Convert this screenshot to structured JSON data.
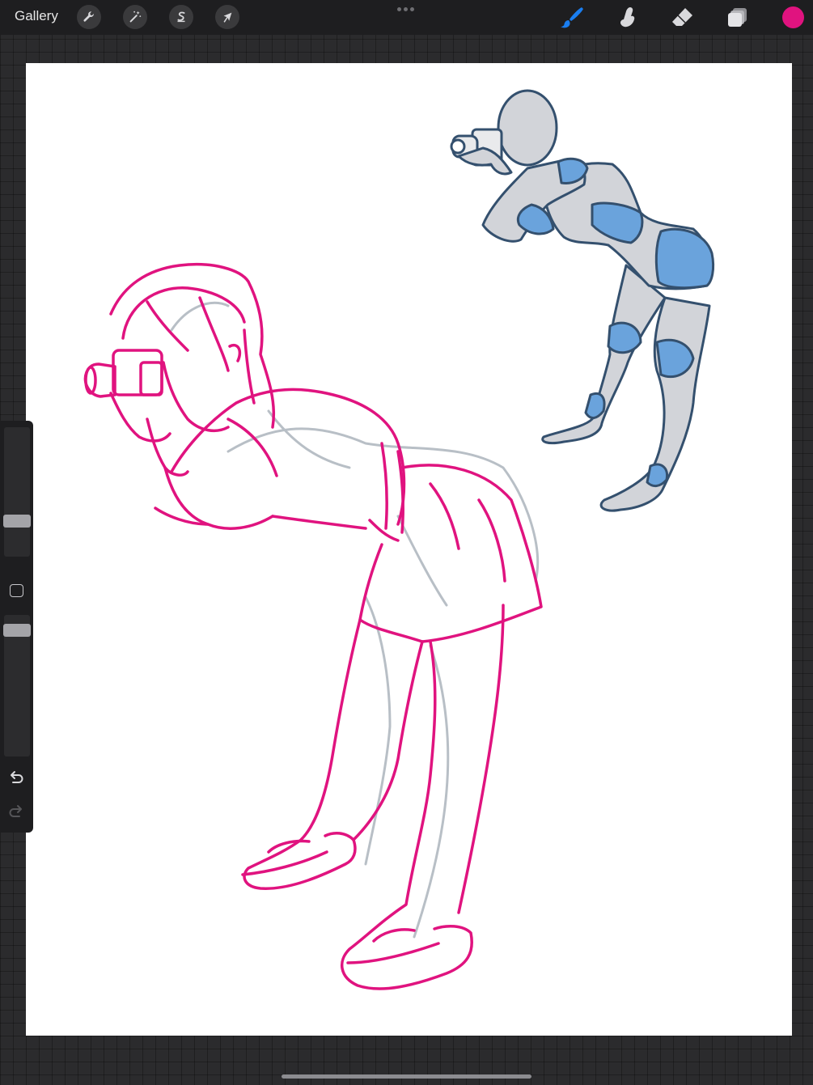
{
  "topbar": {
    "gallery_label": "Gallery",
    "left_tools": [
      {
        "name": "actions",
        "icon": "wrench-icon"
      },
      {
        "name": "adjustments",
        "icon": "magic-wand-icon"
      },
      {
        "name": "selection",
        "icon": "selection-s-icon"
      },
      {
        "name": "transform",
        "icon": "arrow-cursor-icon"
      }
    ],
    "right_tools": [
      {
        "name": "brush",
        "icon": "brush-icon",
        "active": true
      },
      {
        "name": "smudge",
        "icon": "smudge-finger-icon",
        "active": false
      },
      {
        "name": "eraser",
        "icon": "eraser-icon",
        "active": false
      },
      {
        "name": "layers",
        "icon": "layers-icon",
        "active": false
      }
    ],
    "active_color": "#e0137f"
  },
  "sidebar": {
    "brush_size": 0.29,
    "brush_opacity": 0.95,
    "modify_icon": "square-icon",
    "undo_icon": "undo-arrow-icon",
    "redo_icon": "redo-arrow-icon"
  },
  "colors": {
    "accent_blue": "#1a7ef0",
    "sketch_pink": "#e0137f",
    "mannequin_blue": "#6aa3dc",
    "mannequin_outline": "#34506e"
  }
}
